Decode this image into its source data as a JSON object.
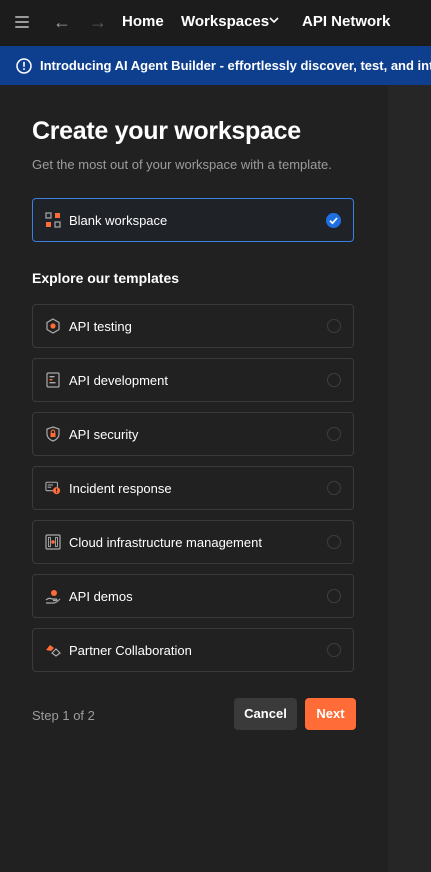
{
  "topbar": {
    "home": "Home",
    "workspaces": "Workspaces",
    "api_network": "API Network"
  },
  "banner": {
    "text": "Introducing AI Agent Builder - effortlessly discover, test, and integrate"
  },
  "page": {
    "title": "Create your workspace",
    "subtitle": "Get the most out of your workspace with a template.",
    "blank_workspace": "Blank workspace",
    "templates_heading": "Explore our templates",
    "templates": [
      {
        "label": "API testing",
        "icon": "hexagon-gear-icon"
      },
      {
        "label": "API development",
        "icon": "document-code-icon"
      },
      {
        "label": "API security",
        "icon": "shield-lock-icon"
      },
      {
        "label": "Incident response",
        "icon": "monitor-alert-icon"
      },
      {
        "label": "Cloud infrastructure management",
        "icon": "server-grid-icon"
      },
      {
        "label": "API demos",
        "icon": "hand-api-icon"
      },
      {
        "label": "Partner Collaboration",
        "icon": "handshake-icon"
      }
    ],
    "step": "Step 1 of 2",
    "cancel": "Cancel",
    "next": "Next"
  },
  "colors": {
    "accent": "#ff6c37",
    "selected_border": "#3b7fe0",
    "banner_bg": "#0e3f8f"
  }
}
